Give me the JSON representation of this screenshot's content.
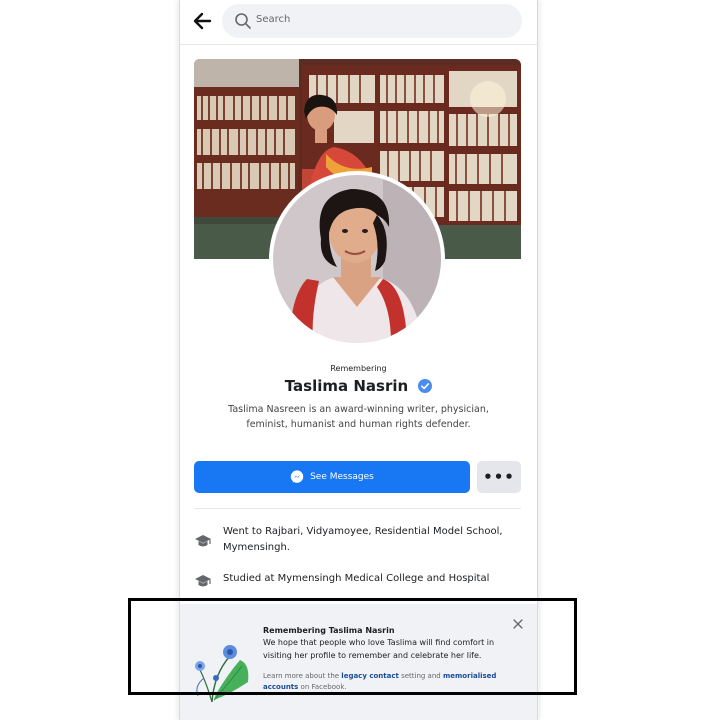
{
  "search": {
    "placeholder": "Search"
  },
  "profile": {
    "status_label": "Remembering",
    "name": "Taslima Nasrin",
    "bio": "Taslima Nasreen is an award-winning writer, physician, feminist, humanist and human rights defender.",
    "message_button_label": "See Messages",
    "more_button_label": "•••"
  },
  "intro": [
    {
      "icon": "graduation-cap-icon",
      "text": "Went to Rajbari, Vidyamoyee, Residential Model School, Mymensingh."
    },
    {
      "icon": "graduation-cap-icon",
      "text": "Studied at Mymensingh Medical College and Hospital"
    }
  ],
  "memorial_banner": {
    "title": "Remembering Taslima Nasrin",
    "body": "We hope that people who love Taslima will find comfort in visiting her profile to remember and celebrate her life.",
    "foot_prefix": "Learn more about the ",
    "legacy_link": "legacy contact",
    "foot_middle": " setting and ",
    "memorialised_link": "memorialised accounts",
    "foot_suffix": " on Facebook."
  },
  "colors": {
    "primary": "#1877f2",
    "verified": "#4a8cf0",
    "link": "#1a4b9b",
    "banner_bg": "#f0f2f5"
  }
}
